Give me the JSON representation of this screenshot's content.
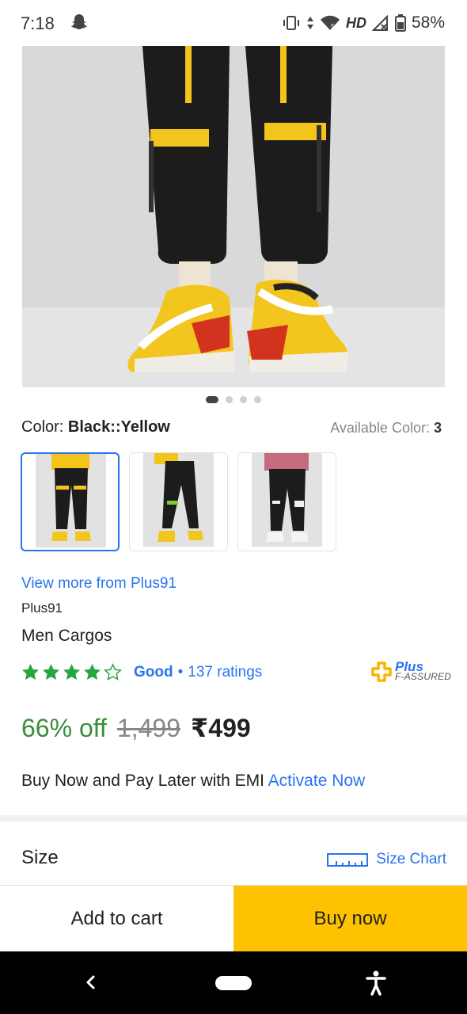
{
  "status_bar": {
    "time": "7:18",
    "network_label": "HD",
    "battery_percent": "58%",
    "icons": [
      "snapchat-icon",
      "vibrate-icon",
      "data-arrows-icon",
      "wifi-icon",
      "signal-icon",
      "battery-icon"
    ]
  },
  "gallery": {
    "image_count": 4,
    "active_index": 0
  },
  "color": {
    "label": "Color:",
    "value": "Black::Yellow",
    "available_label": "Available Color:",
    "available_count": "3",
    "thumbnail_count": 3,
    "selected_thumbnail": 0
  },
  "product": {
    "view_more": "View more from Plus91",
    "brand": "Plus91",
    "name": "Men Cargos"
  },
  "rating": {
    "stars": 4,
    "max_stars": 5,
    "label": "Good",
    "separator": "•",
    "count_text": "137 ratings"
  },
  "assured": {
    "line1": "Plus",
    "line2": "F-ASSURED"
  },
  "price": {
    "discount": "66% off",
    "mrp": "1,499",
    "final": "₹499"
  },
  "emi": {
    "text": "Buy Now and Pay Later with EMI",
    "link": "Activate Now"
  },
  "size": {
    "title": "Size",
    "chart_link": "Size Chart"
  },
  "actions": {
    "add_to_cart": "Add to cart",
    "buy_now": "Buy now"
  },
  "colors": {
    "flipkart_blue": "#2874f0",
    "discount_green": "#388e3c",
    "buy_yellow": "#ffc200",
    "star_green": "#26a541"
  }
}
